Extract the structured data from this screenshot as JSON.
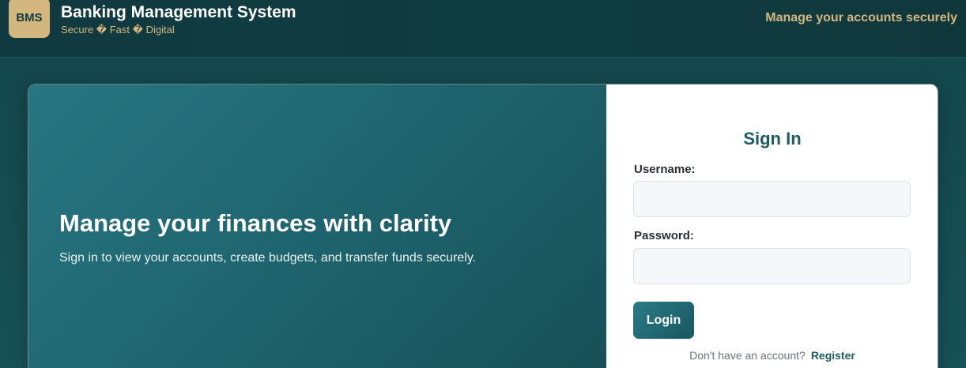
{
  "header": {
    "logo_text": "BMS",
    "title": "Banking Management System",
    "subtitle": "Secure � Fast � Digital",
    "tagline": "Manage your accounts securely"
  },
  "hero": {
    "title": "Manage your finances with clarity",
    "subtitle": "Sign in to view your accounts, create budgets, and transfer funds securely."
  },
  "login_form": {
    "title": "Sign In",
    "username_label": "Username:",
    "username_value": "",
    "password_label": "Password:",
    "password_value": "",
    "login_label": "Login",
    "register_prompt": "Don't have an account?",
    "register_link": "Register"
  },
  "colors": {
    "header_bg": "#0f3c41",
    "accent_gold": "#d3b77f",
    "primary_teal": "#1d5c63",
    "hero_gradient_start": "#277682",
    "hero_gradient_end": "#174f56"
  }
}
